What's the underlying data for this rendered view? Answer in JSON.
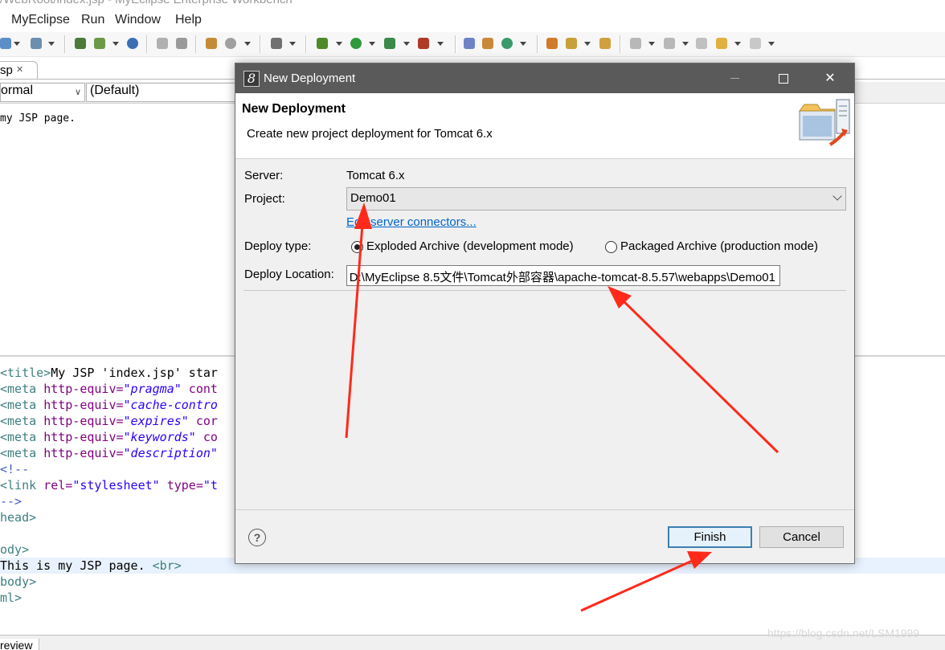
{
  "window": {
    "title": "/WebRoot/index.jsp - MyEclipse Enterprise Workbench"
  },
  "menu": [
    "MyEclipse",
    "Run",
    "Window",
    "Help"
  ],
  "editor": {
    "tab_label": "sp",
    "tab_close": "✕",
    "mode_select": "ormal",
    "default_select": "(Default)",
    "design_preview_text": "my JSP page.",
    "bottom_tab": "review"
  },
  "code_lines": [
    "<title>My JSP 'index.jsp' star",
    "<meta http-equiv=\"pragma\" cont",
    "<meta http-equiv=\"cache-contro",
    "<meta http-equiv=\"expires\" cor",
    "<meta http-equiv=\"keywords\" co",
    "<meta http-equiv=\"description\"",
    "<!--",
    "<link rel=\"stylesheet\" type=\"t",
    "-->",
    "head>",
    "",
    "ody>",
    "This is my JSP page. <br>",
    "body>",
    "ml>"
  ],
  "code_parts": {
    "title": {
      "open": "<title>",
      "text": "My JSP 'index.jsp' star"
    },
    "meta_tag": "<meta",
    "http_equiv": "http-equiv=",
    "pragma": "\"pragma\"",
    "pragma_rest": " cont",
    "cache": "\"cache-contro",
    "expires": "\"expires\"",
    "expires_rest": " cor",
    "keywords": "\"keywords\"",
    "keywords_rest": " co",
    "description": "\"description\"",
    "comment_open": "<!--",
    "link_tag": "<link",
    "rel_attr": " rel=",
    "rel_val": "\"stylesheet\"",
    "type_attr": " type=",
    "type_val": "\"t",
    "comment_close": "-->",
    "head_close": "head>",
    "body_open": "ody>",
    "body_text": "This is my JSP page. ",
    "br": "<br>",
    "body_close": "body>",
    "html_close": "ml>"
  },
  "dialog": {
    "title": "New Deployment",
    "header": "New Deployment",
    "description": "Create new project deployment for Tomcat  6.x",
    "server_label": "Server:",
    "server_value": "Tomcat  6.x",
    "project_label": "Project:",
    "project_value": "Demo01",
    "edit_link": "Edit server connectors...",
    "deploy_type_label": "Deploy type:",
    "deploy_options": [
      "Exploded Archive (development mode)",
      "Packaged Archive (production mode)"
    ],
    "deploy_selected": "Exploded Archive (development mode)",
    "location_label": "Deploy Location:",
    "location_value": "D:\\MyEclipse 8.5文件\\Tomcat外部容器\\apache-tomcat-8.5.57\\webapps\\Demo01",
    "help": "?",
    "finish": "Finish",
    "cancel": "Cancel"
  },
  "watermark": "https://blog.csdn.net/LSM1999",
  "colors": {
    "annotation_arrow": "#ff2a1a",
    "dialog_title_bg": "#5a5a5a",
    "link": "#0066cc",
    "default_button_border": "#3c7fb1"
  },
  "icons": [
    "minimize-icon",
    "maximize-icon",
    "close-icon",
    "help-icon",
    "deploy-banner-icon",
    "myeclipse-app-icon"
  ]
}
